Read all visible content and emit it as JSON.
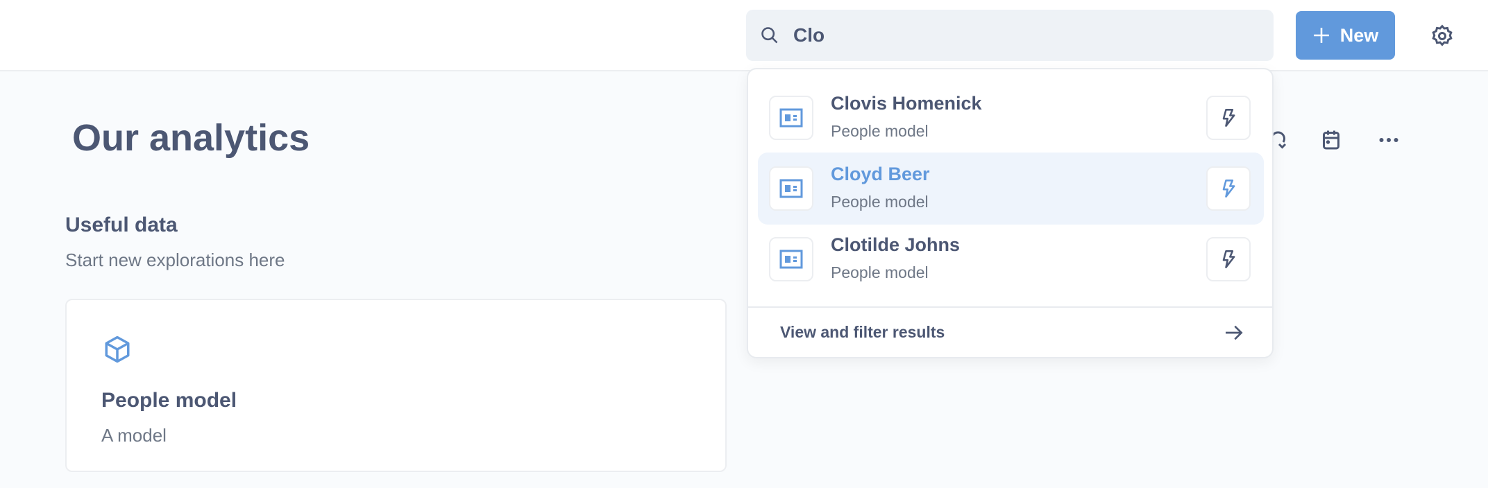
{
  "header": {
    "search": {
      "value": "Clo",
      "placeholder": "Search…"
    },
    "new_label": "New"
  },
  "page": {
    "title": "Our analytics",
    "section_title": "Useful data",
    "section_subtitle": "Start new explorations here",
    "card": {
      "title": "People model",
      "subtitle": "A model"
    }
  },
  "search_results": {
    "items": [
      {
        "name": "Clovis Homenick",
        "type": "People model",
        "highlighted": false
      },
      {
        "name": "Cloyd Beer",
        "type": "People model",
        "highlighted": true
      },
      {
        "name": "Clotilde Johns",
        "type": "People model",
        "highlighted": false
      }
    ],
    "footer_label": "View and filter results"
  },
  "colors": {
    "brand": "#6199dc",
    "text": "#4c5773",
    "highlight_bg": "#eef4fc"
  }
}
